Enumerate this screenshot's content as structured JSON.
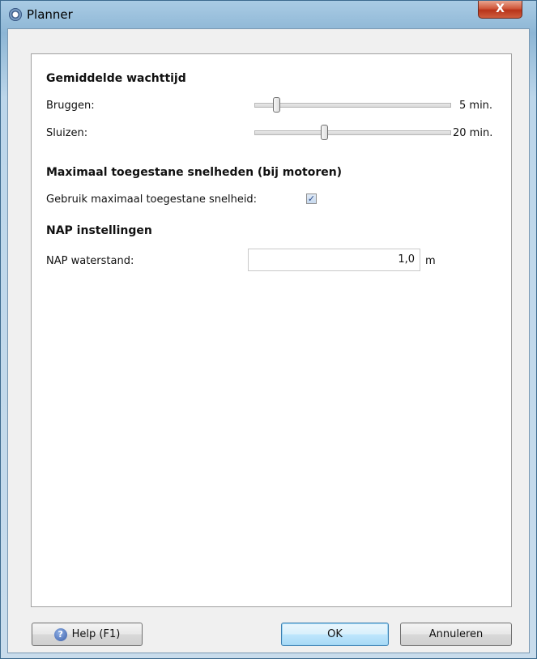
{
  "window": {
    "title": "Planner",
    "close_label": "X"
  },
  "wachttijd": {
    "heading": "Gemiddelde wachttijd",
    "bruggen": {
      "label": "Bruggen:",
      "value_text": "5 min.",
      "fraction": 0.1
    },
    "sluizen": {
      "label": "Sluizen:",
      "value_text": "20 min.",
      "fraction": 0.35
    }
  },
  "snelheden": {
    "heading": "Maximaal toegestane snelheden (bij motoren)",
    "checkbox_label": "Gebruik maximaal toegestane snelheid:",
    "checked": true,
    "check_glyph": "✓"
  },
  "nap": {
    "heading": "NAP instellingen",
    "label": "NAP waterstand:",
    "value": "1,0",
    "unit": "m"
  },
  "buttons": {
    "help_icon": "?",
    "help": "Help (F1)",
    "ok": "OK",
    "cancel": "Annuleren"
  }
}
